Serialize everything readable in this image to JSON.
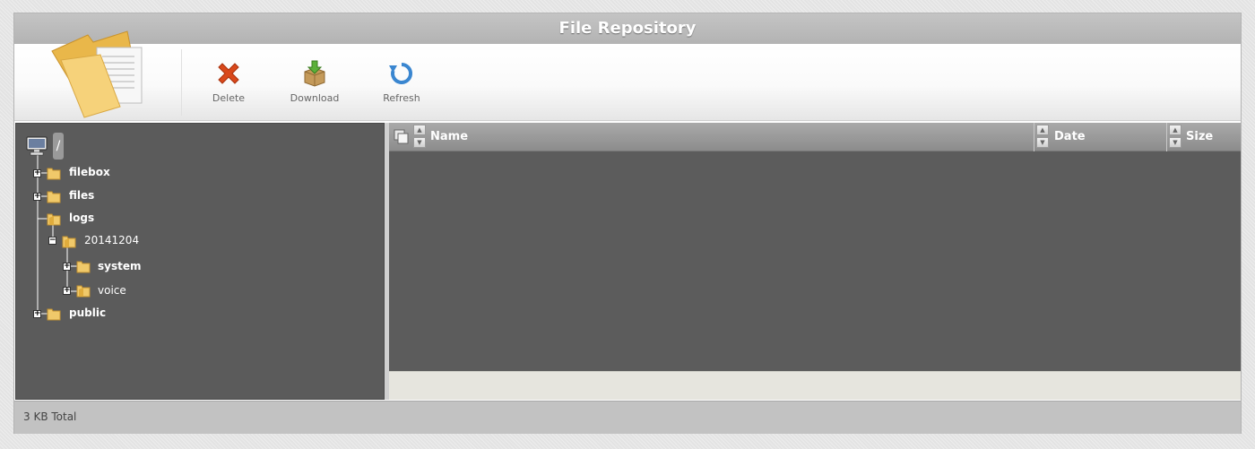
{
  "window": {
    "title": "File Repository"
  },
  "toolbar": {
    "delete_label": "Delete",
    "download_label": "Download",
    "refresh_label": "Refresh"
  },
  "tree": {
    "root_label": "/",
    "nodes": [
      {
        "label": "filebox",
        "expander": "+"
      },
      {
        "label": "files",
        "expander": "+"
      },
      {
        "label": "logs",
        "expander": ""
      },
      {
        "label": "20141204",
        "expander": "−"
      },
      {
        "label": "system",
        "expander": "+"
      },
      {
        "label": "voice",
        "expander": "+"
      },
      {
        "label": "public",
        "expander": "+"
      }
    ]
  },
  "grid": {
    "columns": [
      {
        "label": "Name"
      },
      {
        "label": "Date"
      },
      {
        "label": "Size"
      }
    ]
  },
  "status": {
    "total_text": "3 KB Total"
  },
  "colors": {
    "panel_bg": "#5b5b5b",
    "folder": "#f0c96a",
    "delete_icon": "#d44a1e",
    "refresh_icon": "#3a86d0"
  }
}
